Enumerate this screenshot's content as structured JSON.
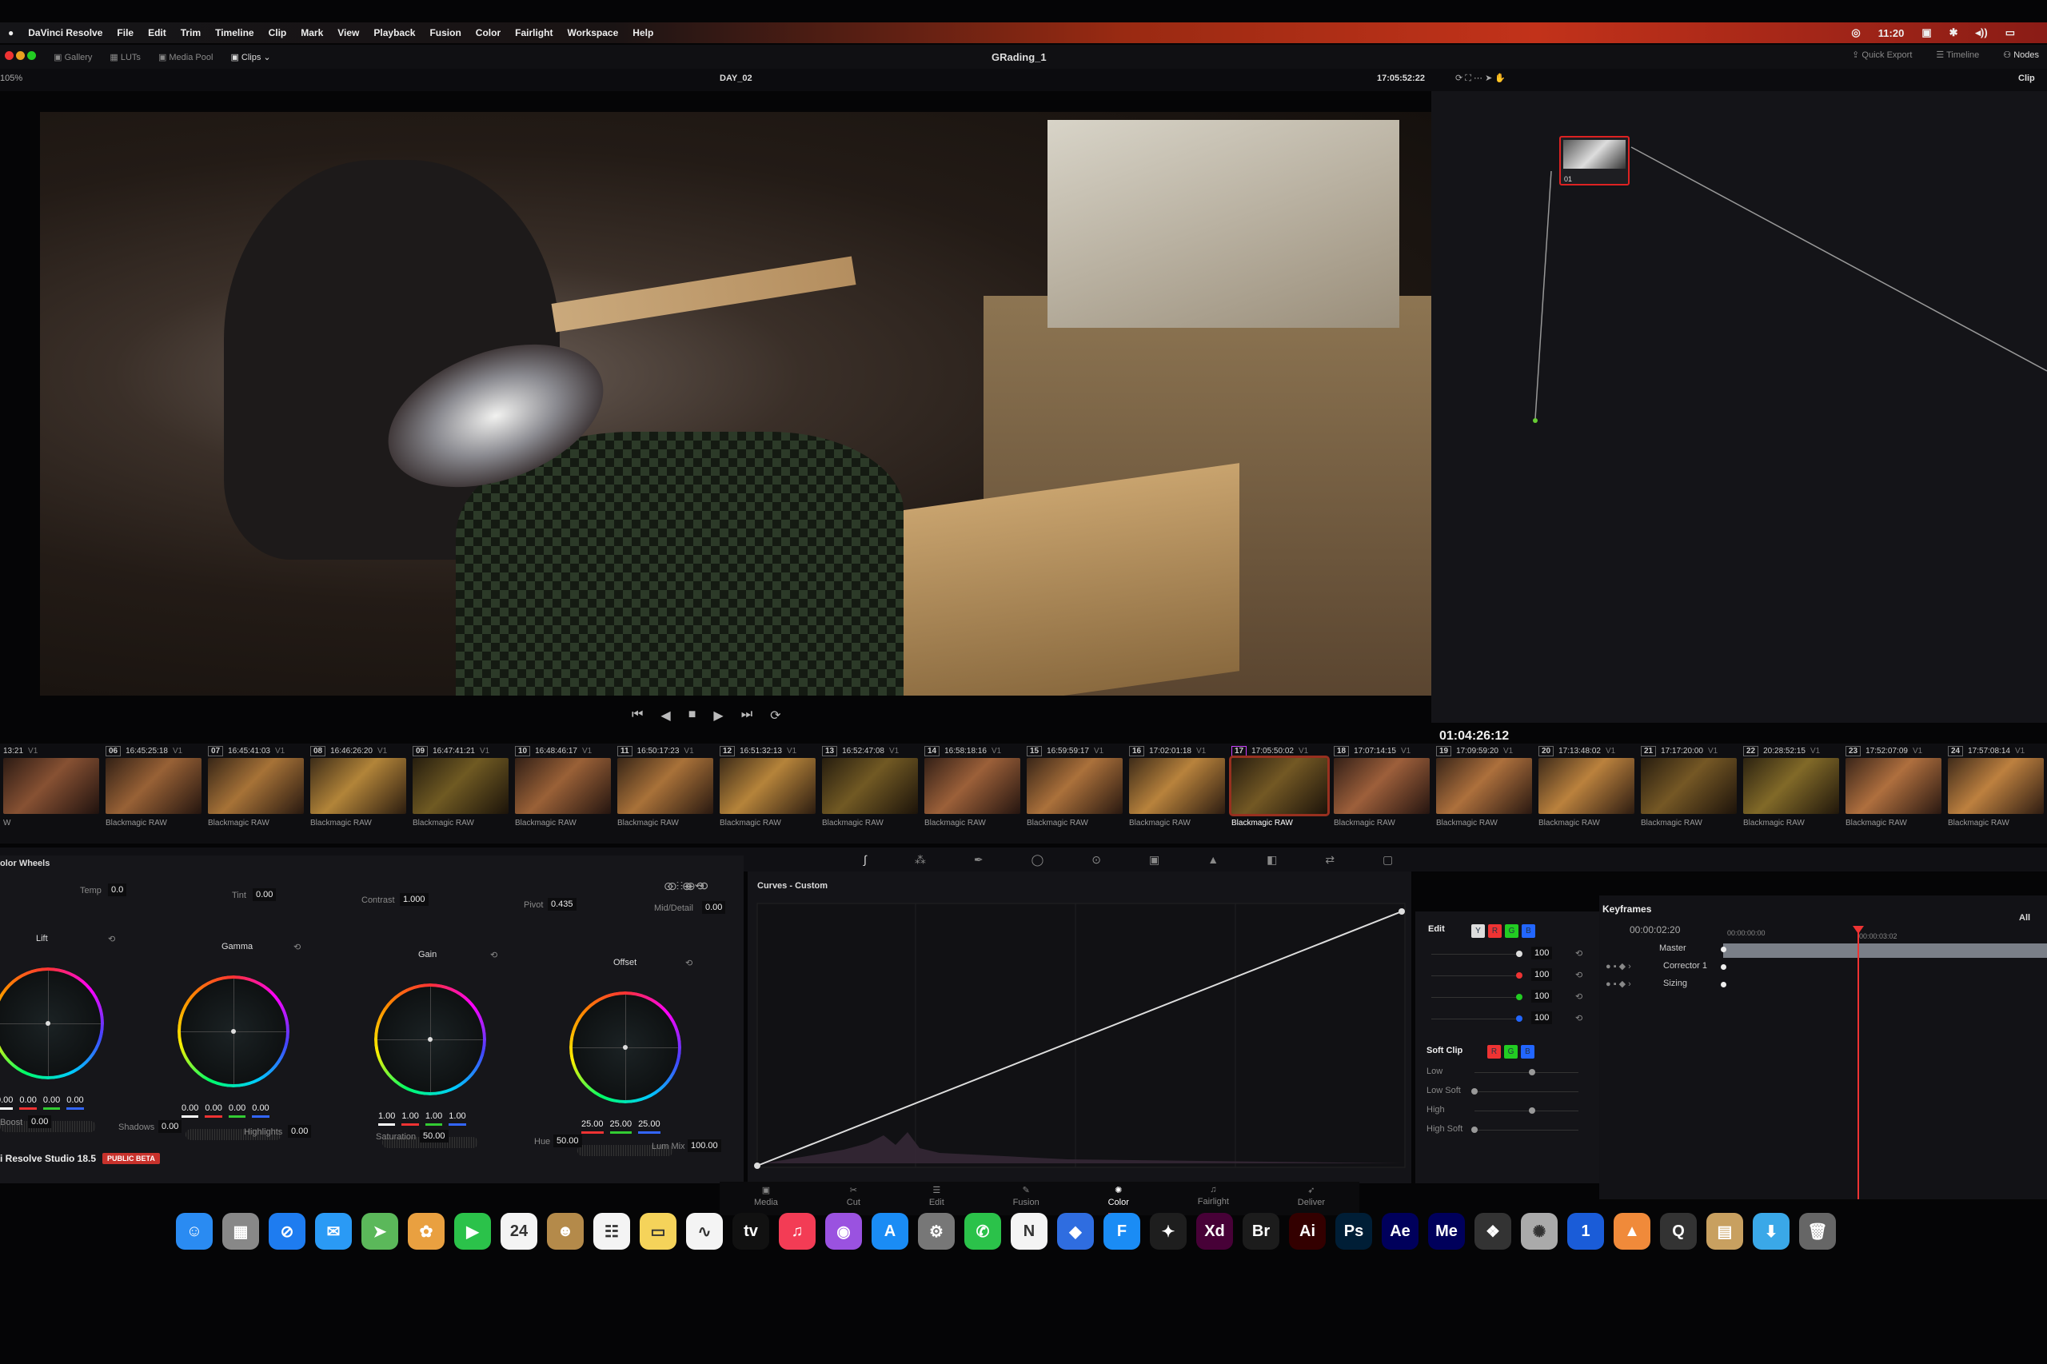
{
  "menubar": {
    "apple": "",
    "app": "DaVinci Resolve",
    "items": [
      "File",
      "Edit",
      "Trim",
      "Timeline",
      "Clip",
      "Mark",
      "View",
      "Playback",
      "Fusion",
      "Color",
      "Fairlight",
      "Workspace",
      "Help"
    ],
    "time": "11:20"
  },
  "toolbar": {
    "gallery": "Gallery",
    "luts": "LUTs",
    "media_pool": "Media Pool",
    "clips": "Clips",
    "title": "GRading_1",
    "quick_export": "Quick Export",
    "timeline": "Timeline",
    "nodes": "Nodes"
  },
  "viewer_bar": {
    "zoom": "105%",
    "timeline_name": "DAY_02",
    "timecode": "17:05:52:22",
    "mode": "Clip"
  },
  "node": {
    "label": "01"
  },
  "transport": {
    "master_timecode": "01:04:26:12"
  },
  "clips": [
    {
      "num": "",
      "tc": "13:21",
      "track": "V1",
      "label": "W"
    },
    {
      "num": "06",
      "tc": "16:45:25:18",
      "track": "V1",
      "label": "Blackmagic RAW"
    },
    {
      "num": "07",
      "tc": "16:45:41:03",
      "track": "V1",
      "label": "Blackmagic RAW"
    },
    {
      "num": "08",
      "tc": "16:46:26:20",
      "track": "V1",
      "label": "Blackmagic RAW"
    },
    {
      "num": "09",
      "tc": "16:47:41:21",
      "track": "V1",
      "label": "Blackmagic RAW"
    },
    {
      "num": "10",
      "tc": "16:48:46:17",
      "track": "V1",
      "label": "Blackmagic RAW"
    },
    {
      "num": "11",
      "tc": "16:50:17:23",
      "track": "V1",
      "label": "Blackmagic RAW"
    },
    {
      "num": "12",
      "tc": "16:51:32:13",
      "track": "V1",
      "label": "Blackmagic RAW"
    },
    {
      "num": "13",
      "tc": "16:52:47:08",
      "track": "V1",
      "label": "Blackmagic RAW"
    },
    {
      "num": "14",
      "tc": "16:58:18:16",
      "track": "V1",
      "label": "Blackmagic RAW"
    },
    {
      "num": "15",
      "tc": "16:59:59:17",
      "track": "V1",
      "label": "Blackmagic RAW"
    },
    {
      "num": "16",
      "tc": "17:02:01:18",
      "track": "V1",
      "label": "Blackmagic RAW"
    },
    {
      "num": "17",
      "tc": "17:05:50:02",
      "track": "V1",
      "label": "Blackmagic RAW",
      "selected": true
    },
    {
      "num": "18",
      "tc": "17:07:14:15",
      "track": "V1",
      "label": "Blackmagic RAW"
    },
    {
      "num": "19",
      "tc": "17:09:59:20",
      "track": "V1",
      "label": "Blackmagic RAW"
    },
    {
      "num": "20",
      "tc": "17:13:48:02",
      "track": "V1",
      "label": "Blackmagic RAW"
    },
    {
      "num": "21",
      "tc": "17:17:20:00",
      "track": "V1",
      "label": "Blackmagic RAW"
    },
    {
      "num": "22",
      "tc": "20:28:52:15",
      "track": "V1",
      "label": "Blackmagic RAW"
    },
    {
      "num": "23",
      "tc": "17:52:07:09",
      "track": "V1",
      "label": "Blackmagic RAW"
    },
    {
      "num": "24",
      "tc": "17:57:08:14",
      "track": "V1",
      "label": "Blackmagic RAW"
    }
  ],
  "wheels": {
    "title": "olor Wheels",
    "params": {
      "temp_label": "Temp",
      "temp": "0.0",
      "tint_label": "Tint",
      "tint": "0.00",
      "contrast_label": "Contrast",
      "contrast": "1.000",
      "pivot_label": "Pivot",
      "pivot": "0.435",
      "middetail_label": "Mid/Detail",
      "middetail": "0.00"
    },
    "lift": {
      "label": "Lift",
      "values": [
        "0.00",
        "0.00",
        "0.00",
        "0.00"
      ]
    },
    "gamma": {
      "label": "Gamma",
      "values": [
        "0.00",
        "0.00",
        "0.00",
        "0.00"
      ]
    },
    "gain": {
      "label": "Gain",
      "values": [
        "1.00",
        "1.00",
        "1.00",
        "1.00"
      ]
    },
    "offset": {
      "label": "Offset",
      "values": [
        "25.00",
        "25.00",
        "25.00"
      ]
    },
    "bottom": {
      "boost_label": "Boost",
      "boost": "0.00",
      "shadows_label": "Shadows",
      "shadows": "0.00",
      "highlights_label": "Highlights",
      "highlights": "0.00",
      "saturation_label": "Saturation",
      "saturation": "50.00",
      "hue_label": "Hue",
      "hue": "50.00",
      "lummix_label": "Lum Mix",
      "lummix": "100.00"
    }
  },
  "curves": {
    "title": "Curves - Custom"
  },
  "edit": {
    "title": "Edit",
    "channels": [
      "Y",
      "R",
      "G",
      "B"
    ],
    "values": [
      "100",
      "100",
      "100",
      "100"
    ],
    "softclip_title": "Soft Clip",
    "softclip_channels": [
      "R",
      "G",
      "B"
    ],
    "softclip_rows": [
      "Low",
      "Low Soft",
      "High",
      "High Soft"
    ]
  },
  "keyframes": {
    "title": "Keyframes",
    "filter": "All",
    "current_tc": "00:00:02:20",
    "ruler": [
      "00:00:00:00",
      "00:00:03:02"
    ],
    "tracks": [
      "Master",
      "Corrector 1",
      "Sizing"
    ]
  },
  "footer": {
    "version": "i Resolve Studio 18.5",
    "badge": "PUBLIC BETA"
  },
  "pages": [
    {
      "label": "Media",
      "icon": "▣"
    },
    {
      "label": "Cut",
      "icon": "✂"
    },
    {
      "label": "Edit",
      "icon": "☰"
    },
    {
      "label": "Fusion",
      "icon": "✎"
    },
    {
      "label": "Color",
      "icon": "✺",
      "active": true
    },
    {
      "label": "Fairlight",
      "icon": "♫"
    },
    {
      "label": "Deliver",
      "icon": "➶"
    }
  ],
  "dock": [
    {
      "name": "finder",
      "glyph": "☺",
      "color": "#2a8bf2"
    },
    {
      "name": "launchpad",
      "glyph": "▦",
      "color": "#888"
    },
    {
      "name": "safari",
      "glyph": "⊘",
      "color": "#1e7cf0"
    },
    {
      "name": "mail",
      "glyph": "✉",
      "color": "#2a9af5"
    },
    {
      "name": "maps",
      "glyph": "➤",
      "color": "#5bb85a"
    },
    {
      "name": "photos",
      "glyph": "✿",
      "color": "#e9a040"
    },
    {
      "name": "facetime",
      "glyph": "▶",
      "color": "#2bc24a"
    },
    {
      "name": "calendar",
      "glyph": "24",
      "color": "#f4f4f4"
    },
    {
      "name": "contacts",
      "glyph": "☻",
      "color": "#b48a4a"
    },
    {
      "name": "reminders",
      "glyph": "☷",
      "color": "#f4f4f4"
    },
    {
      "name": "notes",
      "glyph": "▭",
      "color": "#f5d35a"
    },
    {
      "name": "freeform",
      "glyph": "∿",
      "color": "#f4f4f4"
    },
    {
      "name": "apple-tv",
      "glyph": "tv",
      "color": "#111"
    },
    {
      "name": "music",
      "glyph": "♫",
      "color": "#f33c55"
    },
    {
      "name": "podcasts",
      "glyph": "◉",
      "color": "#9a52e0"
    },
    {
      "name": "app-store",
      "glyph": "A",
      "color": "#1a8cf5"
    },
    {
      "name": "system-settings",
      "glyph": "⚙",
      "color": "#777"
    },
    {
      "name": "messages",
      "glyph": "✆",
      "color": "#2bc24a"
    },
    {
      "name": "notion",
      "glyph": "N",
      "color": "#f4f4f4"
    },
    {
      "name": "app-blue-1",
      "glyph": "◆",
      "color": "#2f6de0"
    },
    {
      "name": "app-blue-2",
      "glyph": "F",
      "color": "#1a8cf5"
    },
    {
      "name": "figma",
      "glyph": "✦",
      "color": "#1e1e1e"
    },
    {
      "name": "adobe-xd",
      "glyph": "Xd",
      "color": "#470137"
    },
    {
      "name": "adobe-bridge",
      "glyph": "Br",
      "color": "#1c1c1c"
    },
    {
      "name": "adobe-illustrator",
      "glyph": "Ai",
      "color": "#330000"
    },
    {
      "name": "adobe-photoshop",
      "glyph": "Ps",
      "color": "#001e36"
    },
    {
      "name": "adobe-after-effects",
      "glyph": "Ae",
      "color": "#00005b"
    },
    {
      "name": "adobe-media-encoder",
      "glyph": "Me",
      "color": "#00005b"
    },
    {
      "name": "davinci-resolve",
      "glyph": "❖",
      "color": "#333"
    },
    {
      "name": "app-silver",
      "glyph": "✺",
      "color": "#aaa"
    },
    {
      "name": "1password",
      "glyph": "1",
      "color": "#1a5cd8"
    },
    {
      "name": "app-fox",
      "glyph": "▲",
      "color": "#f08a3a"
    },
    {
      "name": "quicktime",
      "glyph": "Q",
      "color": "#333"
    },
    {
      "name": "archive-utility",
      "glyph": "▤",
      "color": "#c8a060"
    },
    {
      "name": "downloads-folder",
      "glyph": "⬇",
      "color": "#3aa8e8"
    },
    {
      "name": "trash",
      "glyph": "🗑",
      "color": "#666"
    }
  ],
  "colors": {
    "accent": "#e33b3b",
    "menubar_red": "#c2321a"
  }
}
